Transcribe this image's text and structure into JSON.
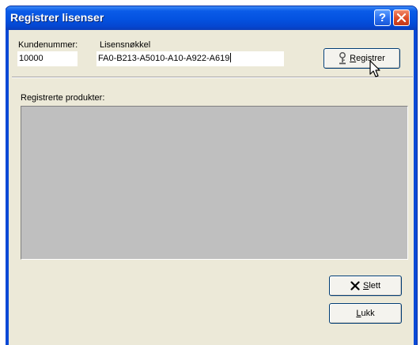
{
  "window": {
    "title": "Registrer lisenser",
    "help_glyph": "?",
    "close_icon": "close-icon"
  },
  "form": {
    "customer_label": "Kundenummer:",
    "customer_value": "10000",
    "license_label": "Lisensnøkkel",
    "license_value": "FA0-B213-A5010-A10-A922-A619"
  },
  "buttons": {
    "register_label": "Registrer",
    "register_icon": "key-icon",
    "delete_label": "Slett",
    "delete_icon": "x-icon",
    "close_label": "Lukk"
  },
  "products": {
    "label": "Registrerte produkter:",
    "items": []
  },
  "colors": {
    "title_blue": "#0452e0",
    "dialog_bg": "#ece9d8",
    "list_bg": "#bfbfbf",
    "close_red": "#dd4a24"
  }
}
